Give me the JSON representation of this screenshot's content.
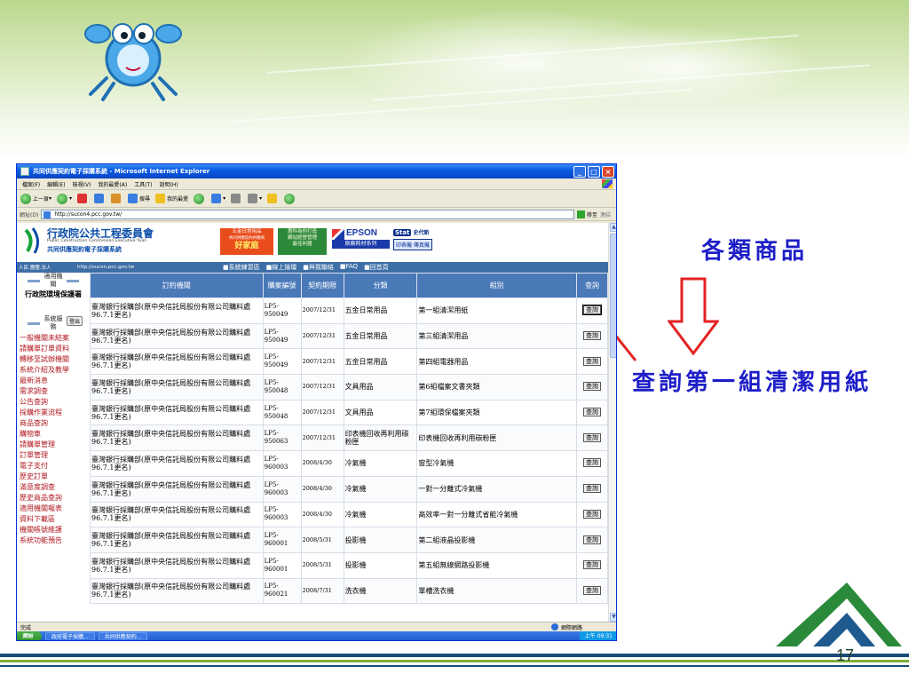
{
  "slide": {
    "annotation_1": "各類商品",
    "annotation_2": "查詢第一組清潔用紙",
    "page_number": "17"
  },
  "window": {
    "title": "共同供應契約電子採購系統 - Microsoft Internet Explorer",
    "menu": [
      "檔案(F)",
      "編輯(E)",
      "檢視(V)",
      "我的最愛(A)",
      "工具(T)",
      "說明(H)"
    ],
    "toolbar": {
      "back": "上一頁",
      "search": "搜尋",
      "favorites": "我的最愛"
    },
    "address_label": "網址(D)",
    "address": "http://sucon4.pcc.gov.tw/",
    "go": "移至",
    "links": "連結"
  },
  "site": {
    "org_name": "行政院公共工程委員會",
    "org_en": "Public Construction Commission Executive Yuan",
    "site_name": "共同供應契約電子採購系統",
    "banner1_line1": "五金日常用品",
    "banner1_line2": "共同供應契約供應商",
    "banner1_big": "好家庭",
    "banner2_lines": [
      "惠科為你打造",
      "網站經營管理",
      "最佳利器"
    ],
    "epson_brand": "EPSON",
    "epson_sub": "原廠耗材系列",
    "stat_badge": "Stat",
    "stat_cn": "史代新",
    "stat_sub": "印表機 傳真機",
    "nav_left": "人民.團體.法人",
    "nav_url": "http://sucon.pcc.gov.tw",
    "nav_links": [
      "■系統練習區",
      "■線上論壇",
      "■與我聯絡",
      "■FAQ",
      "■回首頁"
    ]
  },
  "sidebar": {
    "head1": "適用機關",
    "agency": "行政院環境保護署",
    "logout": "登出",
    "head2": "系統服務",
    "links": [
      "一般機關未結案",
      "請購單訂單資料",
      "轉移至試辦機關",
      "系統介紹及教學",
      "最新消息",
      "需求調查",
      "公告查詢",
      "採購作業流程",
      "商品查詢",
      "購物車",
      "請購單管理",
      "訂單管理",
      "電子支付",
      "歷史訂單",
      "滿意度調查",
      "歷史商品查詢",
      "適用機關報表",
      "資料下載區",
      "機關帳號維護",
      "系統功能預告"
    ]
  },
  "table": {
    "headers": [
      "訂約機關",
      "購案編號",
      "契約期限",
      "分類",
      "組別",
      "查詢"
    ],
    "button_label": "查詢",
    "rows": [
      {
        "agency": "臺灣銀行採購部(原中央信託局股份有限公司購料處96.7.1更名)",
        "no": "LP5-950049",
        "date": "2007/12/31",
        "category": "五金日常用品",
        "group": "第一組清潔用紙"
      },
      {
        "agency": "臺灣銀行採購部(原中央信託局股份有限公司購料處96.7.1更名)",
        "no": "LP5-950049",
        "date": "2007/12/31",
        "category": "五金日常用品",
        "group": "第三組清潔用品"
      },
      {
        "agency": "臺灣銀行採購部(原中央信託局股份有限公司購料處96.7.1更名)",
        "no": "LP5-950049",
        "date": "2007/12/31",
        "category": "五金日常用品",
        "group": "第四組電器用品"
      },
      {
        "agency": "臺灣銀行採購部(原中央信託局股份有限公司購料處96.7.1更名)",
        "no": "LP5-950048",
        "date": "2007/12/31",
        "category": "文具用品",
        "group": "第6組檔案文書夾類"
      },
      {
        "agency": "臺灣銀行採購部(原中央信託局股份有限公司購料處96.7.1更名)",
        "no": "LP5-950048",
        "date": "2007/12/31",
        "category": "文具用品",
        "group": "第7組環保檔案夾類"
      },
      {
        "agency": "臺灣銀行採購部(原中央信託局股份有限公司購料處96.7.1更名)",
        "no": "LP5-950063",
        "date": "2007/12/31",
        "category": "印表機回收再利用碳粉匣",
        "group": "印表機回收再利用碳粉匣"
      },
      {
        "agency": "臺灣銀行採購部(原中央信託局股份有限公司購料處96.7.1更名)",
        "no": "LP5-960003",
        "date": "2008/4/30",
        "category": "冷氣機",
        "group": "窗型冷氣機"
      },
      {
        "agency": "臺灣銀行採購部(原中央信託局股份有限公司購料處96.7.1更名)",
        "no": "LP5-960003",
        "date": "2008/4/30",
        "category": "冷氣機",
        "group": "一對一分離式冷氣機"
      },
      {
        "agency": "臺灣銀行採購部(原中央信託局股份有限公司購料處96.7.1更名)",
        "no": "LP5-960003",
        "date": "2008/4/30",
        "category": "冷氣機",
        "group": "高效率一對一分離式省能冷氣機"
      },
      {
        "agency": "臺灣銀行採購部(原中央信託局股份有限公司購料處96.7.1更名)",
        "no": "LP5-960001",
        "date": "2008/5/31",
        "category": "投影機",
        "group": "第二組液晶投影機"
      },
      {
        "agency": "臺灣銀行採購部(原中央信託局股份有限公司購料處96.7.1更名)",
        "no": "LP5-960001",
        "date": "2008/5/31",
        "category": "投影機",
        "group": "第五組無線網路投影機"
      },
      {
        "agency": "臺灣銀行採購部(原中央信託局股份有限公司購料處96.7.1更名)",
        "no": "LP5-960021",
        "date": "2008/7/31",
        "category": "洗衣機",
        "group": "單槽洗衣機"
      }
    ]
  },
  "status": {
    "text": "完成",
    "zone": "網際網路"
  },
  "taskbar": {
    "start": "開始",
    "tasks": [
      "政府電子採購...",
      "共同供應契約..."
    ],
    "clock": "上午 09:31"
  },
  "colors": {
    "annotation": "#1e1ec8",
    "table_header": "#4a79b8",
    "sidebar_link": "#b0171f",
    "nav_bar": "#3d6fa6"
  }
}
